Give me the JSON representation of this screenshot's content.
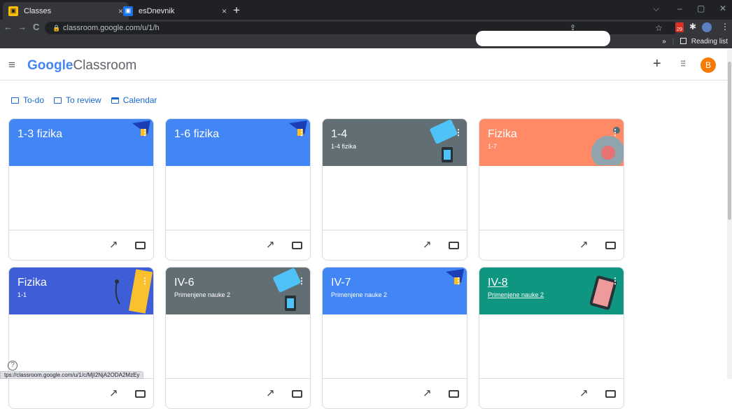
{
  "browser": {
    "tabs": [
      {
        "title": "Classes",
        "close": "×"
      },
      {
        "title": "esDnevnik",
        "close": "×"
      }
    ],
    "new_tab": "+",
    "window_controls": {
      "chevron": "⌵",
      "minimize": "–",
      "restore": "▢",
      "close": "✕"
    },
    "nav": {
      "back": "←",
      "forward": "→",
      "reload": "C"
    },
    "url": "classroom.google.com/u/1/h",
    "lock": "🔒",
    "star": "☆",
    "share": "⇪",
    "bookmarks": {
      "chevron": "»",
      "reading_list": "Reading list"
    },
    "extension_badge": "29"
  },
  "header": {
    "menu_icon": "≡",
    "brand_google": "Google",
    "brand_product": "Classroom",
    "plus": "+",
    "apps": "⁝⁝⁝",
    "avatar_letter": "B"
  },
  "subnav": [
    {
      "label": "To-do"
    },
    {
      "label": "To review"
    },
    {
      "label": "Calendar"
    }
  ],
  "cards": [
    {
      "title": "1-3 fizika",
      "subtitle": "",
      "color": "#4285f4"
    },
    {
      "title": "1-6 fizika",
      "subtitle": "",
      "color": "#4285f4"
    },
    {
      "title": "1-4",
      "subtitle": "1-4 fizika",
      "color": "#616e73"
    },
    {
      "title": "Fizika",
      "subtitle": "1-7",
      "color": "#ff8a65"
    },
    {
      "title": "Fizika",
      "subtitle": "1-1",
      "color": "#3d5ed6"
    },
    {
      "title": "IV-6",
      "subtitle": "Primenjene nauke 2",
      "color": "#616e73"
    },
    {
      "title": "IV-7",
      "subtitle": "Primenjene nauke 2",
      "color": "#4285f4"
    },
    {
      "title": "IV-8",
      "subtitle": "Primenjene nauke 2",
      "color": "#0e9681"
    }
  ],
  "icons": {
    "trend": "↗",
    "kebab": "⋮",
    "help": "?"
  },
  "status_url": "tps://classroom.google.com/u/1/c/MjI2NjA2ODA2MzEy"
}
